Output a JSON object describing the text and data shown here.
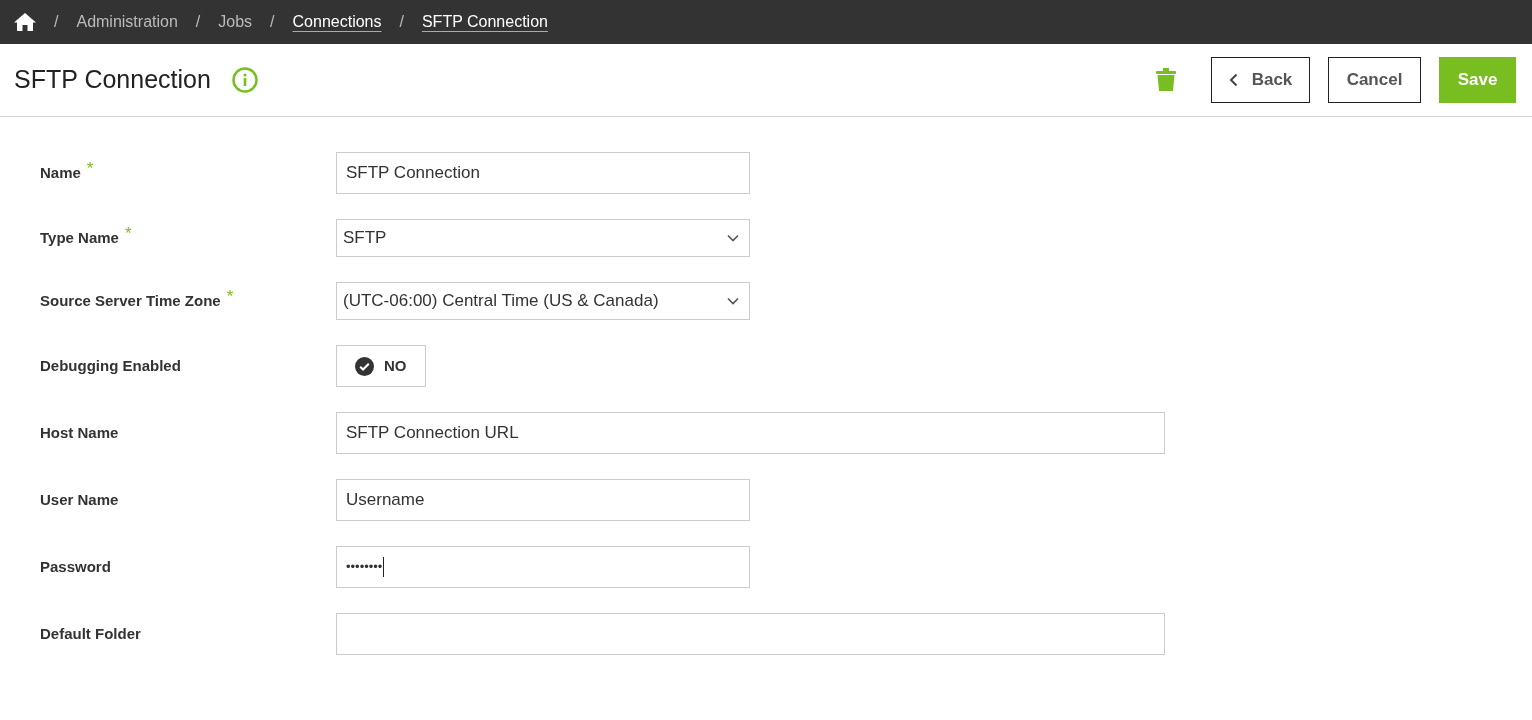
{
  "breadcrumb": [
    {
      "label": "Administration",
      "link": false,
      "separator_before": "/"
    },
    {
      "label": "Jobs",
      "link": false,
      "separator_before": "/"
    },
    {
      "label": "Connections",
      "link": true,
      "separator_before": "/"
    },
    {
      "label": "SFTP Connection",
      "link": true,
      "separator_before": "/"
    }
  ],
  "page": {
    "title": "SFTP Connection"
  },
  "actions": [
    {
      "kind": "back",
      "label": "Back"
    },
    {
      "kind": "cancel",
      "label": "Cancel"
    },
    {
      "kind": "save",
      "label": "Save"
    }
  ],
  "fields": [
    {
      "kind": "text",
      "label": "Name",
      "required_mark": "*",
      "wide": false,
      "value": "SFTP Connection"
    },
    {
      "kind": "select",
      "label": "Type Name",
      "required_mark": "*",
      "wide": false,
      "value": "SFTP"
    },
    {
      "kind": "select",
      "label": "Source Server Time Zone",
      "required_mark": "*",
      "wide": false,
      "value": "(UTC-06:00) Central Time (US & Canada)"
    },
    {
      "kind": "toggle",
      "label": "Debugging Enabled",
      "on": false,
      "value": "NO"
    },
    {
      "kind": "text",
      "label": "Host Name",
      "wide": true,
      "value": "SFTP Connection URL"
    },
    {
      "kind": "text",
      "label": "User Name",
      "wide": false,
      "value": "Username"
    },
    {
      "kind": "password",
      "label": "Password",
      "wide": false,
      "value": "••••••••"
    },
    {
      "kind": "text",
      "label": "Default Folder",
      "wide": true
    }
  ]
}
